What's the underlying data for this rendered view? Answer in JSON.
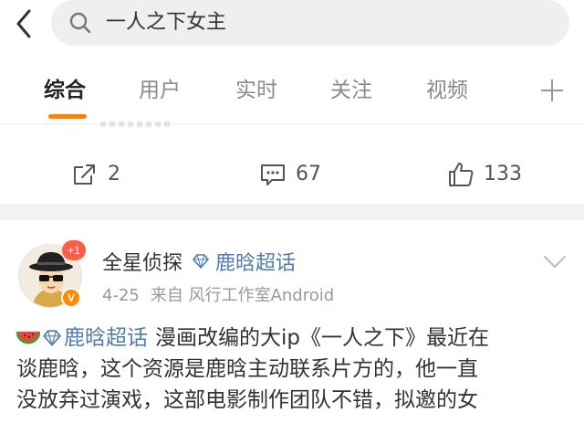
{
  "search": {
    "query": "一人之下女主"
  },
  "tabs": [
    {
      "label": "综合"
    },
    {
      "label": "用户"
    },
    {
      "label": "实时"
    },
    {
      "label": "关注"
    },
    {
      "label": "视频"
    }
  ],
  "prev_post": {
    "repost_count": "2",
    "comment_count": "67",
    "like_count": "133"
  },
  "post": {
    "badge": "+1",
    "author": "全星侦探",
    "topic": "鹿晗超话",
    "time": "4-25",
    "source": "来自 风行工作室Android",
    "verified": "V",
    "text_line1": "漫画改编的大ip《一人之下》最近在",
    "text_line2": "谈鹿晗，这个资源是鹿晗主动联系片方的，他一直",
    "text_line3": "没放弃过演戏，这部电影制作团队不错，拟邀的女"
  },
  "colors": {
    "accent": "#ff8200",
    "link": "#507daf",
    "muted": "#999999"
  }
}
